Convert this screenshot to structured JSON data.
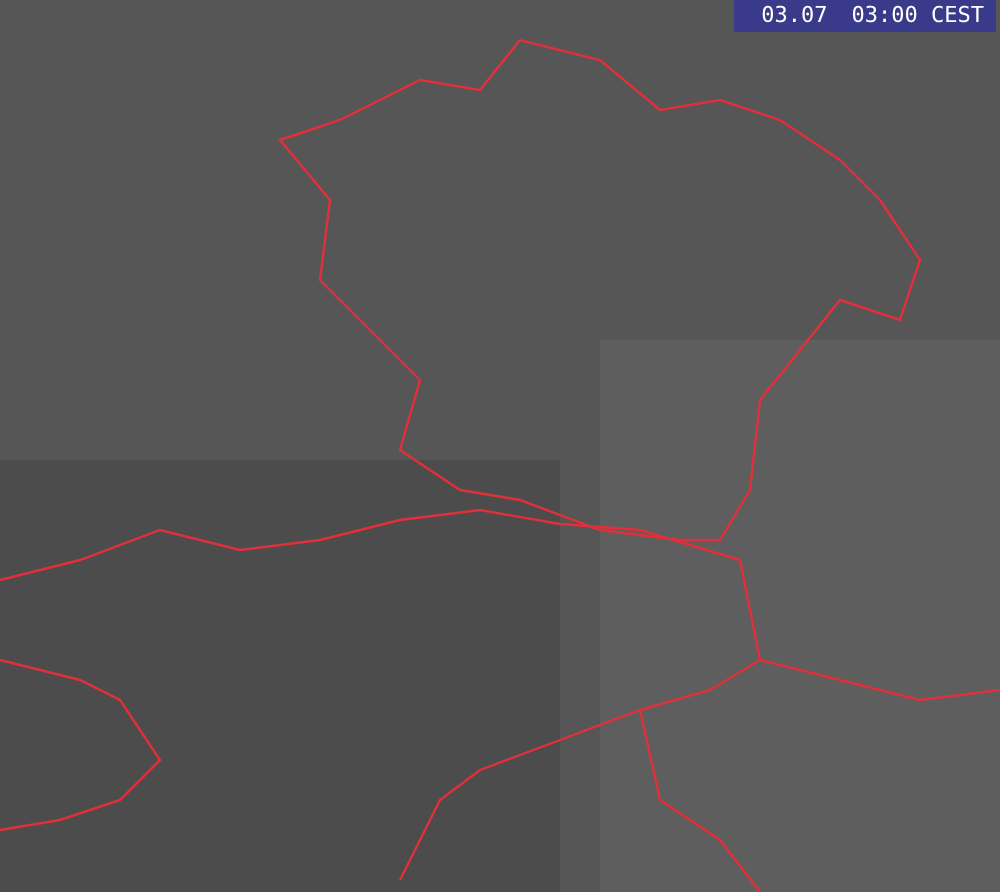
{
  "map": {
    "timestamp": {
      "date": "03.07",
      "time": "03:00 CEST"
    }
  }
}
